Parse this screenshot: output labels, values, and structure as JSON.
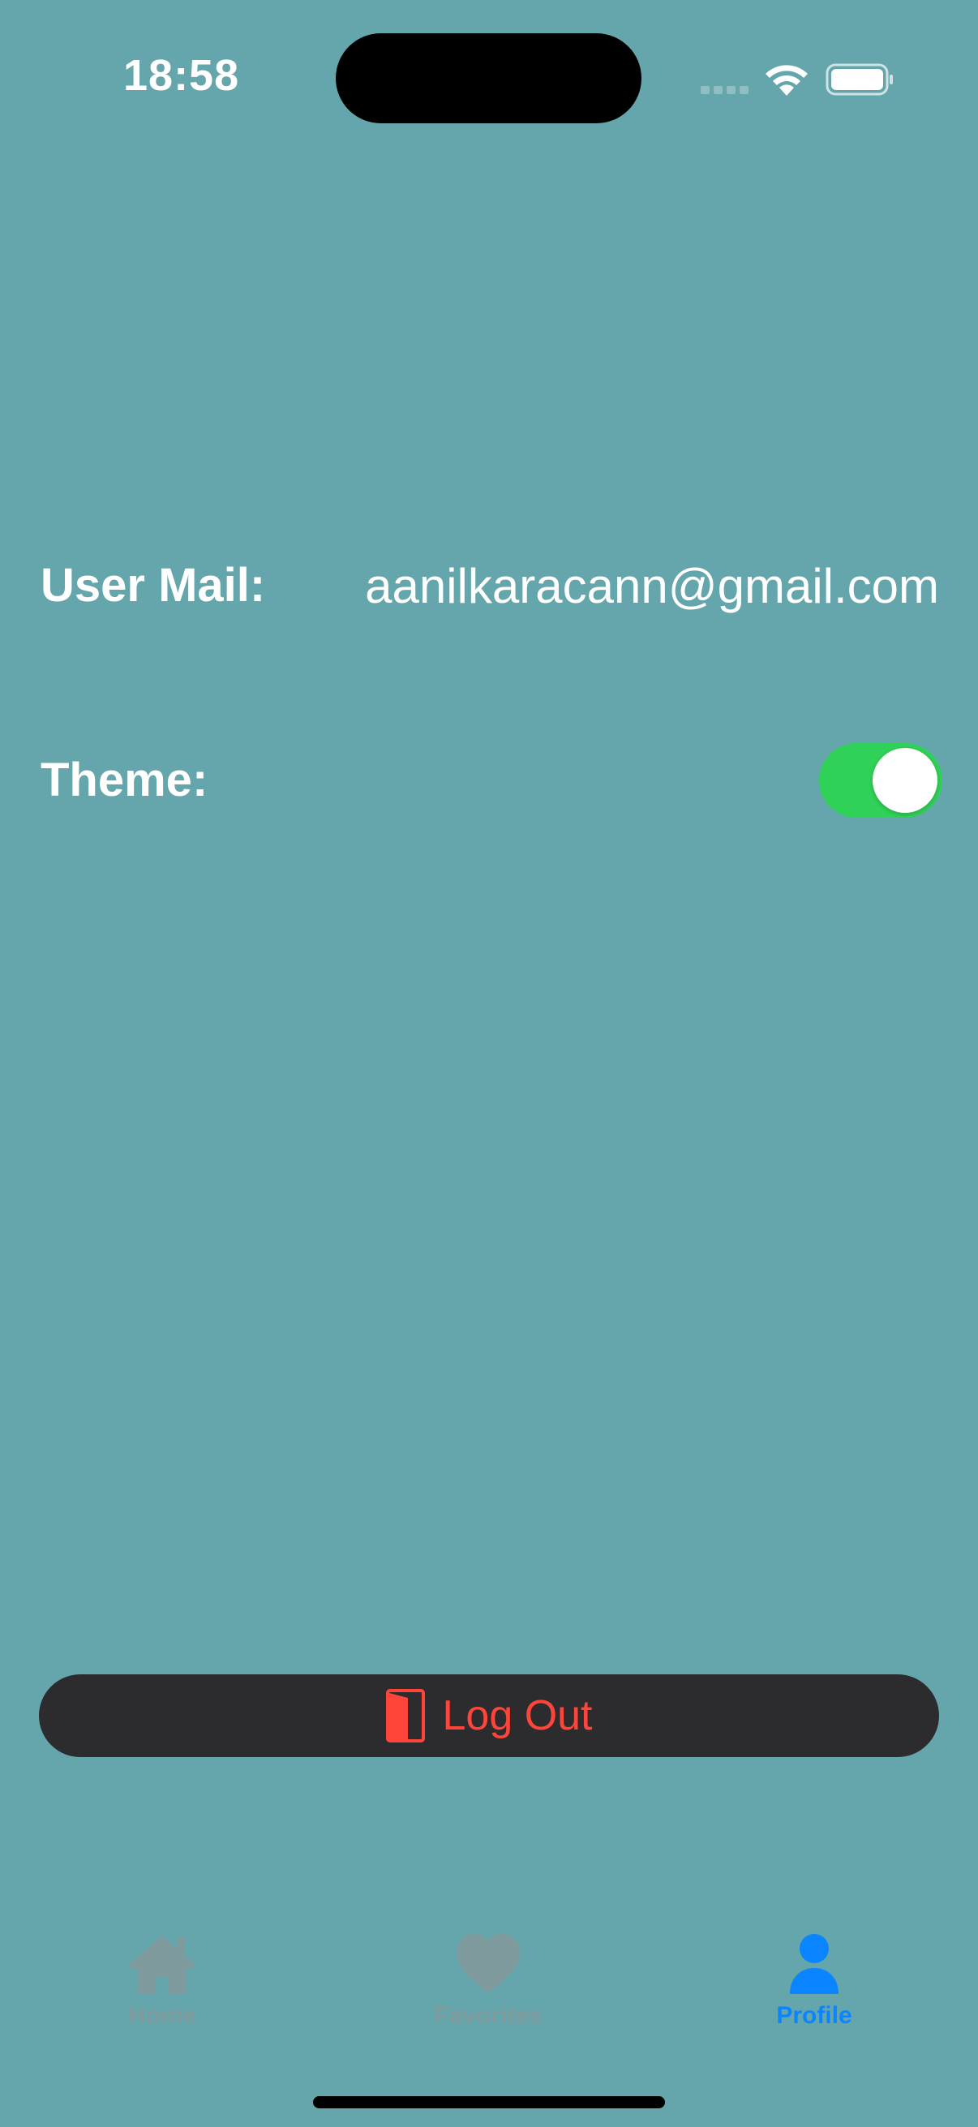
{
  "status_bar": {
    "time": "18:58"
  },
  "profile": {
    "mail_label": "User Mail:",
    "mail_value": "aanilkaracann@gmail.com",
    "theme_label": "Theme:",
    "theme_toggle_on": true
  },
  "logout": {
    "label": "Log Out",
    "icon": "door-icon"
  },
  "tabs": [
    {
      "label": "Home",
      "icon": "house-fill-icon",
      "selected": false
    },
    {
      "label": "Favorites",
      "icon": "heart-fill-icon",
      "selected": false
    },
    {
      "label": "Profile",
      "icon": "person-fill-icon",
      "selected": true
    }
  ],
  "colors": {
    "background": "#64a6ab",
    "accent": "#0a84ff",
    "toggle_on": "#30d158",
    "destructive": "#ff453a",
    "button_bg": "#2c2c2e"
  }
}
